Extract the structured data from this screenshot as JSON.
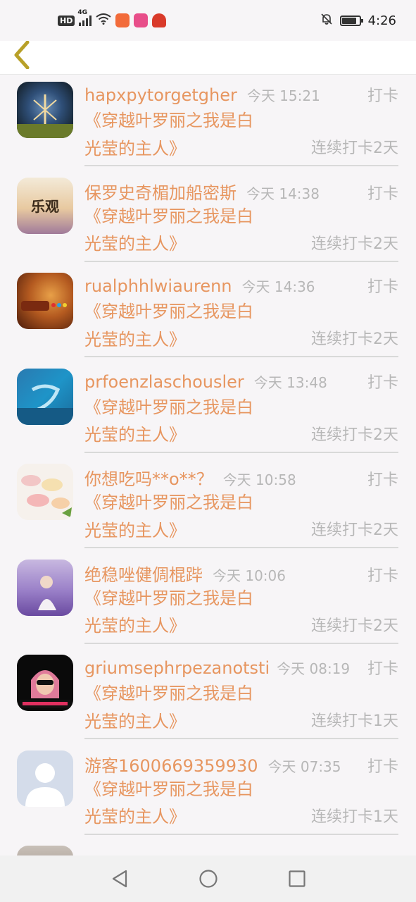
{
  "status_bar": {
    "hd": "HD",
    "network": "4G",
    "time": "4:26",
    "icons": [
      "signal-icon",
      "wifi-icon",
      "app-icon",
      "app-icon",
      "app-icon",
      "mute-icon",
      "battery-icon"
    ],
    "battery_level": 0.85
  },
  "header": {
    "back_icon": "chevron-left-icon"
  },
  "colors": {
    "accent": "#e79660",
    "muted": "#b7b7b7",
    "back": "#b8a028"
  },
  "entries": [
    {
      "username": "hapxpytorgetgher",
      "time": "今天 15:21",
      "action": "打卡",
      "book_line1": "《穿越叶罗丽之我是白",
      "book_line2": "光莹的主人》",
      "streak": "连续打卡2天"
    },
    {
      "username": "保罗史奇楣加船密斯",
      "time": "今天 14:38",
      "action": "打卡",
      "book_line1": "《穿越叶罗丽之我是白",
      "book_line2": "光莹的主人》",
      "streak": "连续打卡2天",
      "avatar_text": "乐观"
    },
    {
      "username": "rualphhlwiaurenn",
      "time": "今天 14:36",
      "action": "打卡",
      "book_line1": "《穿越叶罗丽之我是白",
      "book_line2": "光莹的主人》",
      "streak": "连续打卡2天"
    },
    {
      "username": "prfoenzlaschousler",
      "time": "今天 13:48",
      "action": "打卡",
      "book_line1": "《穿越叶罗丽之我是白",
      "book_line2": "光莹的主人》",
      "streak": "连续打卡2天"
    },
    {
      "username": "你想吃吗**o**？",
      "time": "今天 10:58",
      "action": "打卡",
      "book_line1": "《穿越叶罗丽之我是白",
      "book_line2": "光莹的主人》",
      "streak": "连续打卡2天"
    },
    {
      "username": "绝稳唑健倜棍跸",
      "time": "今天 10:06",
      "action": "打卡",
      "book_line1": "《穿越叶罗丽之我是白",
      "book_line2": "光莹的主人》",
      "streak": "连续打卡2天"
    },
    {
      "username": "griumsephrpezanotsti",
      "time": "今天 08:19",
      "action": "打卡",
      "book_line1": "《穿越叶罗丽之我是白",
      "book_line2": "光莹的主人》",
      "streak": "连续打卡1天"
    },
    {
      "username": "游客1600669359930",
      "time": "今天 07:35",
      "action": "打卡",
      "book_line1": "《穿越叶罗丽之我是白",
      "book_line2": "光莹的主人》",
      "streak": "连续打卡1天"
    }
  ],
  "system_nav": {
    "icons": [
      "back-triangle-icon",
      "home-circle-icon",
      "recents-square-icon"
    ]
  }
}
